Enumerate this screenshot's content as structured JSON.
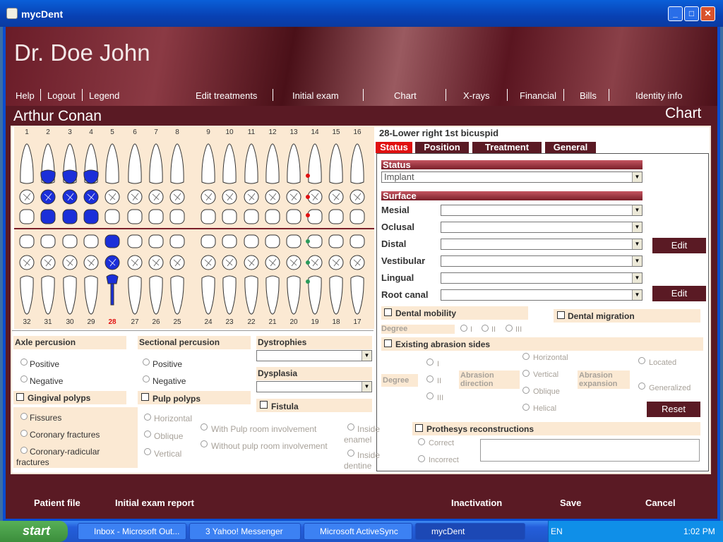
{
  "window": {
    "title": "mycDent"
  },
  "header": {
    "doctor": "Dr. Doe John",
    "patient": "Arthur Conan",
    "section": "Chart"
  },
  "nav": {
    "left": [
      "Help",
      "Logout",
      "Legend"
    ],
    "right": [
      "Edit treatments",
      "Initial exam",
      "Chart",
      "X-rays",
      "Financial",
      "Bills",
      "Identity info"
    ]
  },
  "chart": {
    "upper_numbers": [
      "1",
      "2",
      "3",
      "4",
      "5",
      "6",
      "7",
      "8",
      "9",
      "10",
      "11",
      "12",
      "13",
      "14",
      "15",
      "16"
    ],
    "lower_numbers": [
      "32",
      "31",
      "30",
      "29",
      "28",
      "27",
      "26",
      "25",
      "24",
      "23",
      "22",
      "21",
      "20",
      "19",
      "18",
      "17"
    ],
    "selected_tooth": "28",
    "colors": {
      "treated": "#1b2fd9",
      "selected": "#e01010",
      "mark_red": "#e01010",
      "mark_green": "#2a9a5a"
    }
  },
  "detail": {
    "title": "28-Lower right 1st bicuspid",
    "tabs": [
      "Status",
      "Position",
      "Treatment",
      "General"
    ],
    "status_header": "Status",
    "status_value": "Implant",
    "surface_header": "Surface",
    "surfaces": [
      "Mesial",
      "Oclusal",
      "Distal",
      "Vestibular",
      "Lingual",
      "Root canal"
    ],
    "edit_label": "Edit",
    "reset_label": "Reset",
    "dental_mobility": "Dental mobility",
    "dental_migration": "Dental migration",
    "degree": "Degree",
    "degrees": [
      "I",
      "II",
      "III"
    ],
    "abrasion": "Existing abrasion sides",
    "abrasion_direction": "Abrasion direction",
    "abrasion_expansion": "Abrasion expansion",
    "directions": [
      "Horizontal",
      "Vertical",
      "Oblique",
      "Helical"
    ],
    "expansions": [
      "Located",
      "Generalized"
    ],
    "prosthesis": "Prothesys reconstructions",
    "prosthesis_opts": [
      "Correct",
      "Incorrect"
    ]
  },
  "exam": {
    "axle": "Axle percusion",
    "sectional": "Sectional percusion",
    "dystrophies": "Dystrophies",
    "dysplasia": "Dysplasia",
    "positive": "Positive",
    "negative": "Negative",
    "gingival": "Gingival polyps",
    "pulp": "Pulp polyps",
    "fistula": "Fistula",
    "fractures": [
      "Fissures",
      "Coronary fractures",
      "Coronary-radicular fractures"
    ],
    "pulp_dir": [
      "Horizontal",
      "Oblique",
      "Vertical"
    ],
    "pulp_room": [
      "With Pulp room involvement",
      "Without pulp room involvement"
    ],
    "inside": [
      "Inside enamel",
      "Inside dentine"
    ]
  },
  "footer": {
    "patient_file": "Patient file",
    "exam_report": "Initial exam report",
    "inactivation": "Inactivation",
    "save": "Save",
    "cancel": "Cancel"
  },
  "taskbar": {
    "start": "start",
    "tasks": [
      "Inbox - Microsoft Out...",
      "3 Yahoo! Messenger",
      "Microsoft ActiveSync",
      "mycDent"
    ],
    "lang": "EN",
    "time": "1:02 PM"
  }
}
